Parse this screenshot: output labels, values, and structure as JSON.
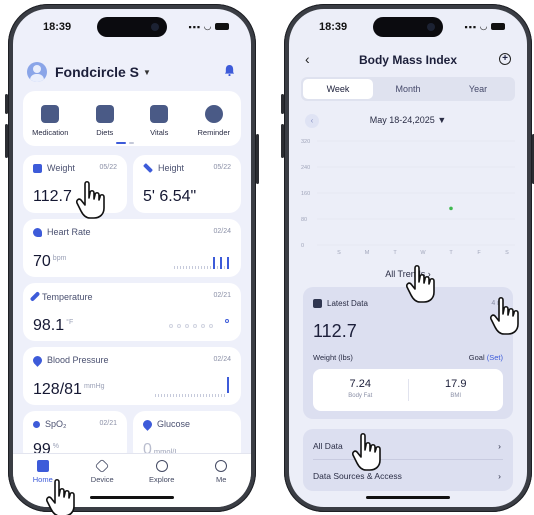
{
  "left": {
    "status_time": "18:39",
    "user_name": "Fondcircle S",
    "quick_actions": [
      {
        "label": "Medication",
        "icon": "medication-icon"
      },
      {
        "label": "Diets",
        "icon": "diets-icon"
      },
      {
        "label": "Vitals",
        "icon": "vitals-icon"
      },
      {
        "label": "Reminder",
        "icon": "reminder-icon"
      }
    ],
    "cards": {
      "weight": {
        "title": "Weight",
        "date": "05/22",
        "value": "112.7"
      },
      "height": {
        "title": "Height",
        "date": "05/22",
        "value": "5' 6.54\""
      },
      "heart_rate": {
        "title": "Heart Rate",
        "date": "02/24",
        "value": "70",
        "unit": "bpm"
      },
      "temperature": {
        "title": "Temperature",
        "date": "02/21",
        "value": "98.1",
        "unit": "°F"
      },
      "blood_pressure": {
        "title": "Blood Pressure",
        "date": "02/24",
        "value": "128/81",
        "unit": "mmHg"
      },
      "spo2": {
        "title": "SpO₂",
        "date": "02/21",
        "value": "99",
        "unit": "%"
      },
      "glucose": {
        "title": "Glucose",
        "value": "0",
        "unit": "mmol/L"
      }
    },
    "tabs": [
      {
        "label": "Home",
        "icon": "home-icon"
      },
      {
        "label": "Device",
        "icon": "device-icon"
      },
      {
        "label": "Explore",
        "icon": "explore-icon"
      },
      {
        "label": "Me",
        "icon": "me-icon"
      }
    ]
  },
  "right": {
    "status_time": "18:39",
    "title": "Body Mass Index",
    "segments": [
      "Week",
      "Month",
      "Year"
    ],
    "selected_segment": "Week",
    "date_range": "May 18-24,2025",
    "all_trends": "All Trends",
    "latest": {
      "label": "Latest Data",
      "meta": "4 m",
      "value": "112.7",
      "unit_label": "Weight (lbs)",
      "goal_label": "Goal",
      "goal_link": "(Set)",
      "body_fat_value": "7.24",
      "body_fat_label": "Body Fat",
      "bmi_value": "17.9",
      "bmi_label": "BMI"
    },
    "list": {
      "all_data": "All Data",
      "data_sources": "Data Sources & Access"
    }
  },
  "chart_data": {
    "type": "scatter",
    "categories": [
      "S",
      "M",
      "T",
      "W",
      "T",
      "F",
      "S"
    ],
    "y_ticks": [
      0,
      80,
      160,
      240,
      320
    ],
    "ylim": [
      0,
      320
    ],
    "points": [
      {
        "x": "T",
        "x_index": 4,
        "y": 112.7
      }
    ],
    "accent": "#3fb950",
    "grid": true
  }
}
